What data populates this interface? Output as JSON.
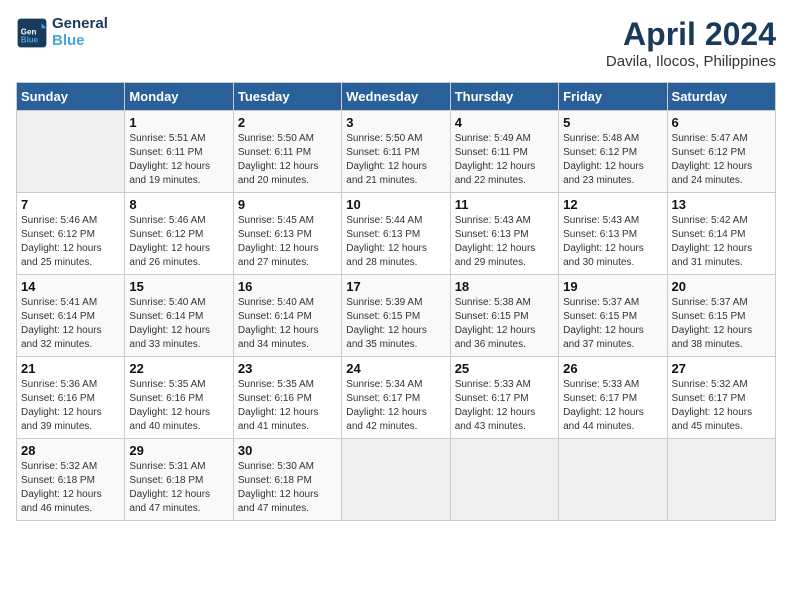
{
  "app": {
    "name": "GeneralBlue",
    "logo_lines": [
      "General",
      "Blue"
    ]
  },
  "calendar": {
    "month_title": "April 2024",
    "location": "Davila, Ilocos, Philippines",
    "headers": [
      "Sunday",
      "Monday",
      "Tuesday",
      "Wednesday",
      "Thursday",
      "Friday",
      "Saturday"
    ],
    "weeks": [
      [
        {
          "day": "",
          "sunrise": "",
          "sunset": "",
          "daylight": ""
        },
        {
          "day": "1",
          "sunrise": "Sunrise: 5:51 AM",
          "sunset": "Sunset: 6:11 PM",
          "daylight": "Daylight: 12 hours and 19 minutes."
        },
        {
          "day": "2",
          "sunrise": "Sunrise: 5:50 AM",
          "sunset": "Sunset: 6:11 PM",
          "daylight": "Daylight: 12 hours and 20 minutes."
        },
        {
          "day": "3",
          "sunrise": "Sunrise: 5:50 AM",
          "sunset": "Sunset: 6:11 PM",
          "daylight": "Daylight: 12 hours and 21 minutes."
        },
        {
          "day": "4",
          "sunrise": "Sunrise: 5:49 AM",
          "sunset": "Sunset: 6:11 PM",
          "daylight": "Daylight: 12 hours and 22 minutes."
        },
        {
          "day": "5",
          "sunrise": "Sunrise: 5:48 AM",
          "sunset": "Sunset: 6:12 PM",
          "daylight": "Daylight: 12 hours and 23 minutes."
        },
        {
          "day": "6",
          "sunrise": "Sunrise: 5:47 AM",
          "sunset": "Sunset: 6:12 PM",
          "daylight": "Daylight: 12 hours and 24 minutes."
        }
      ],
      [
        {
          "day": "7",
          "sunrise": "Sunrise: 5:46 AM",
          "sunset": "Sunset: 6:12 PM",
          "daylight": "Daylight: 12 hours and 25 minutes."
        },
        {
          "day": "8",
          "sunrise": "Sunrise: 5:46 AM",
          "sunset": "Sunset: 6:12 PM",
          "daylight": "Daylight: 12 hours and 26 minutes."
        },
        {
          "day": "9",
          "sunrise": "Sunrise: 5:45 AM",
          "sunset": "Sunset: 6:13 PM",
          "daylight": "Daylight: 12 hours and 27 minutes."
        },
        {
          "day": "10",
          "sunrise": "Sunrise: 5:44 AM",
          "sunset": "Sunset: 6:13 PM",
          "daylight": "Daylight: 12 hours and 28 minutes."
        },
        {
          "day": "11",
          "sunrise": "Sunrise: 5:43 AM",
          "sunset": "Sunset: 6:13 PM",
          "daylight": "Daylight: 12 hours and 29 minutes."
        },
        {
          "day": "12",
          "sunrise": "Sunrise: 5:43 AM",
          "sunset": "Sunset: 6:13 PM",
          "daylight": "Daylight: 12 hours and 30 minutes."
        },
        {
          "day": "13",
          "sunrise": "Sunrise: 5:42 AM",
          "sunset": "Sunset: 6:14 PM",
          "daylight": "Daylight: 12 hours and 31 minutes."
        }
      ],
      [
        {
          "day": "14",
          "sunrise": "Sunrise: 5:41 AM",
          "sunset": "Sunset: 6:14 PM",
          "daylight": "Daylight: 12 hours and 32 minutes."
        },
        {
          "day": "15",
          "sunrise": "Sunrise: 5:40 AM",
          "sunset": "Sunset: 6:14 PM",
          "daylight": "Daylight: 12 hours and 33 minutes."
        },
        {
          "day": "16",
          "sunrise": "Sunrise: 5:40 AM",
          "sunset": "Sunset: 6:14 PM",
          "daylight": "Daylight: 12 hours and 34 minutes."
        },
        {
          "day": "17",
          "sunrise": "Sunrise: 5:39 AM",
          "sunset": "Sunset: 6:15 PM",
          "daylight": "Daylight: 12 hours and 35 minutes."
        },
        {
          "day": "18",
          "sunrise": "Sunrise: 5:38 AM",
          "sunset": "Sunset: 6:15 PM",
          "daylight": "Daylight: 12 hours and 36 minutes."
        },
        {
          "day": "19",
          "sunrise": "Sunrise: 5:37 AM",
          "sunset": "Sunset: 6:15 PM",
          "daylight": "Daylight: 12 hours and 37 minutes."
        },
        {
          "day": "20",
          "sunrise": "Sunrise: 5:37 AM",
          "sunset": "Sunset: 6:15 PM",
          "daylight": "Daylight: 12 hours and 38 minutes."
        }
      ],
      [
        {
          "day": "21",
          "sunrise": "Sunrise: 5:36 AM",
          "sunset": "Sunset: 6:16 PM",
          "daylight": "Daylight: 12 hours and 39 minutes."
        },
        {
          "day": "22",
          "sunrise": "Sunrise: 5:35 AM",
          "sunset": "Sunset: 6:16 PM",
          "daylight": "Daylight: 12 hours and 40 minutes."
        },
        {
          "day": "23",
          "sunrise": "Sunrise: 5:35 AM",
          "sunset": "Sunset: 6:16 PM",
          "daylight": "Daylight: 12 hours and 41 minutes."
        },
        {
          "day": "24",
          "sunrise": "Sunrise: 5:34 AM",
          "sunset": "Sunset: 6:17 PM",
          "daylight": "Daylight: 12 hours and 42 minutes."
        },
        {
          "day": "25",
          "sunrise": "Sunrise: 5:33 AM",
          "sunset": "Sunset: 6:17 PM",
          "daylight": "Daylight: 12 hours and 43 minutes."
        },
        {
          "day": "26",
          "sunrise": "Sunrise: 5:33 AM",
          "sunset": "Sunset: 6:17 PM",
          "daylight": "Daylight: 12 hours and 44 minutes."
        },
        {
          "day": "27",
          "sunrise": "Sunrise: 5:32 AM",
          "sunset": "Sunset: 6:17 PM",
          "daylight": "Daylight: 12 hours and 45 minutes."
        }
      ],
      [
        {
          "day": "28",
          "sunrise": "Sunrise: 5:32 AM",
          "sunset": "Sunset: 6:18 PM",
          "daylight": "Daylight: 12 hours and 46 minutes."
        },
        {
          "day": "29",
          "sunrise": "Sunrise: 5:31 AM",
          "sunset": "Sunset: 6:18 PM",
          "daylight": "Daylight: 12 hours and 47 minutes."
        },
        {
          "day": "30",
          "sunrise": "Sunrise: 5:30 AM",
          "sunset": "Sunset: 6:18 PM",
          "daylight": "Daylight: 12 hours and 47 minutes."
        },
        {
          "day": "",
          "sunrise": "",
          "sunset": "",
          "daylight": ""
        },
        {
          "day": "",
          "sunrise": "",
          "sunset": "",
          "daylight": ""
        },
        {
          "day": "",
          "sunrise": "",
          "sunset": "",
          "daylight": ""
        },
        {
          "day": "",
          "sunrise": "",
          "sunset": "",
          "daylight": ""
        }
      ]
    ]
  }
}
